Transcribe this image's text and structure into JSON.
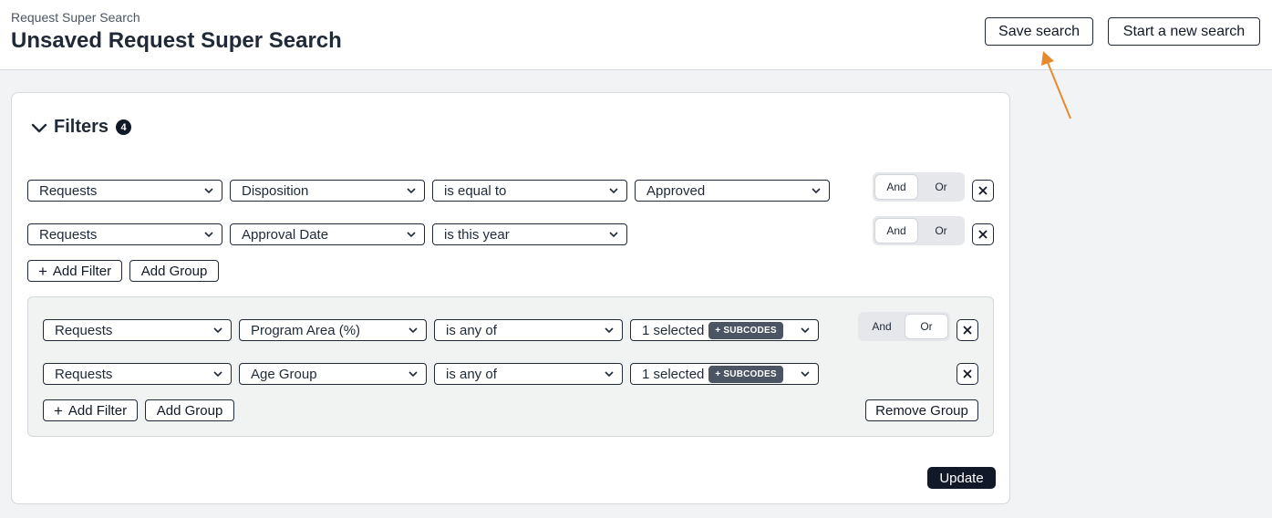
{
  "header": {
    "breadcrumb": "Request Super Search",
    "title": "Unsaved Request Super Search",
    "save_label": "Save search",
    "new_label": "Start a new search"
  },
  "filters": {
    "title": "Filters",
    "count": "4",
    "rows": [
      {
        "entity": "Requests",
        "field": "Disposition",
        "operator": "is equal to",
        "value": "Approved",
        "and": "And",
        "or": "Or"
      },
      {
        "entity": "Requests",
        "field": "Approval Date",
        "operator": "is this year",
        "and": "And",
        "or": "Or"
      }
    ],
    "add_filter": "Add Filter",
    "add_group": "Add Group",
    "group": {
      "rows": [
        {
          "entity": "Requests",
          "field": "Program Area (%)",
          "operator": "is any of",
          "value": "1 selected",
          "badge": "+ SUBCODES",
          "and": "And",
          "or": "Or"
        },
        {
          "entity": "Requests",
          "field": "Age Group",
          "operator": "is any of",
          "value": "1 selected",
          "badge": "+ SUBCODES"
        }
      ],
      "add_filter": "Add Filter",
      "add_group": "Add Group",
      "remove_group": "Remove Group"
    },
    "update": "Update"
  },
  "colors": {
    "annotation_arrow": "#e8892e",
    "dark": "#111827"
  }
}
